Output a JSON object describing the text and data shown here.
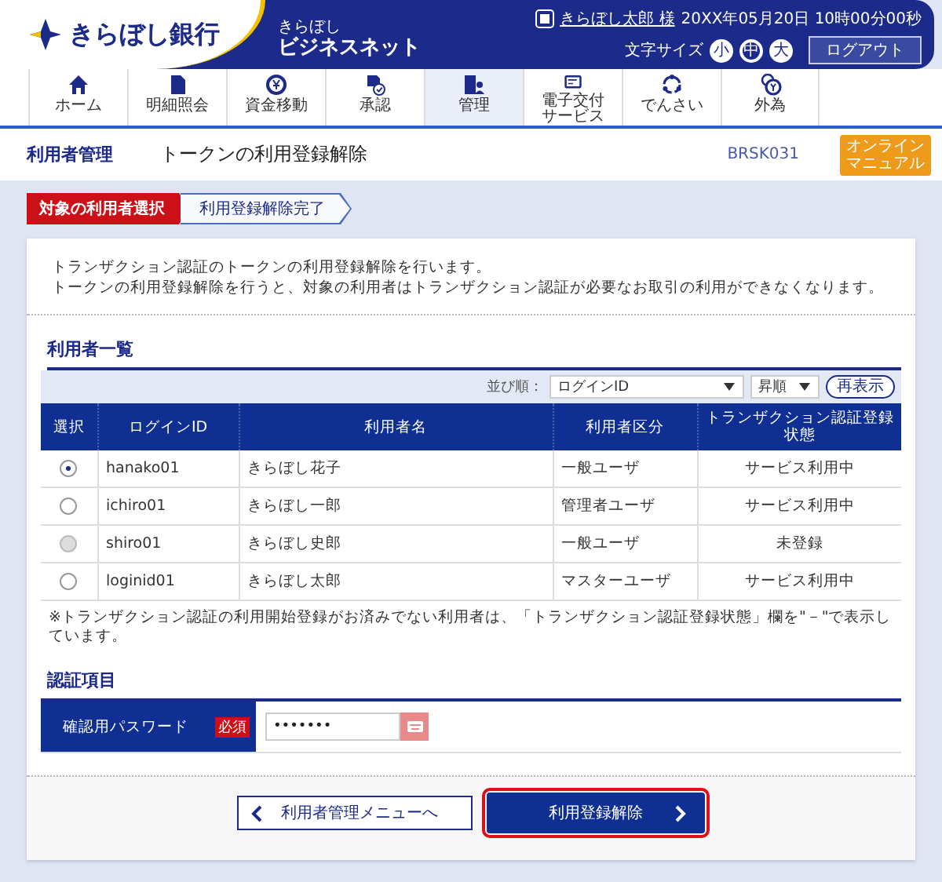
{
  "header": {
    "bank_name": "きらぼし銀行",
    "service_small": "きらぼし",
    "service_name": "ビジネスネット",
    "user_link": "きらぼし太郎 様",
    "datetime": "20XX年05月20日 10時00分00秒",
    "font_size_label": "文字サイズ",
    "font_sizes": [
      {
        "label": "小",
        "selected": false
      },
      {
        "label": "中",
        "selected": true
      },
      {
        "label": "大",
        "selected": false
      }
    ],
    "logout_button": "ログアウト"
  },
  "nav": [
    {
      "label": "ホーム",
      "selected": false
    },
    {
      "label": "明細照会",
      "selected": false
    },
    {
      "label": "資金移動",
      "selected": false
    },
    {
      "label": "承認",
      "selected": false
    },
    {
      "label": "管理",
      "selected": true
    },
    {
      "label": "電子交付サービス",
      "selected": false
    },
    {
      "label": "でんさい",
      "selected": false
    },
    {
      "label": "外為",
      "selected": false
    }
  ],
  "page": {
    "section": "利用者管理",
    "title": "トークンの利用登録解除",
    "screen_id": "BRSK031",
    "manual_button": "オンラインマニュアル"
  },
  "steps": [
    {
      "label": "対象の利用者選択",
      "selected": true
    },
    {
      "label": "利用登録解除完了",
      "selected": false
    }
  ],
  "description": [
    "トランザクション認証のトークンの利用登録解除を行います。",
    "トークンの利用登録解除を行うと、対象の利用者はトランザクション認証が必要なお取引の利用ができなくなります。"
  ],
  "user_list": {
    "heading": "利用者一覧",
    "sort_label": "並び順：",
    "sort_field": "ログインID",
    "sort_order": "昇順",
    "redisplay_button": "再表示",
    "columns": [
      "選択",
      "ログインID",
      "利用者名",
      "利用者区分",
      "トランザクション認証登録状態"
    ],
    "rows": [
      {
        "selected": true,
        "disabled": false,
        "login_id": "hanako01",
        "name": "きらぼし花子",
        "type": "一般ユーザ",
        "status": "サービス利用中"
      },
      {
        "selected": false,
        "disabled": false,
        "login_id": "ichiro01",
        "name": "きらぼし一郎",
        "type": "管理者ユーザ",
        "status": "サービス利用中"
      },
      {
        "selected": false,
        "disabled": true,
        "login_id": "shiro01",
        "name": "きらぼし史郎",
        "type": "一般ユーザ",
        "status": "未登録"
      },
      {
        "selected": false,
        "disabled": false,
        "login_id": "loginid01",
        "name": "きらぼし太郎",
        "type": "マスターユーザ",
        "status": "サービス利用中"
      }
    ],
    "note": "※トランザクション認証の利用開始登録がお済みでない利用者は、「トランザクション認証登録状態」欄を\"－\"で表示しています。"
  },
  "auth": {
    "heading": "認証項目",
    "label": "確認用パスワード",
    "required_badge": "必須",
    "password_value": "•••••••"
  },
  "buttons": {
    "back": "利用者管理メニューへ",
    "submit": "利用登録解除"
  }
}
